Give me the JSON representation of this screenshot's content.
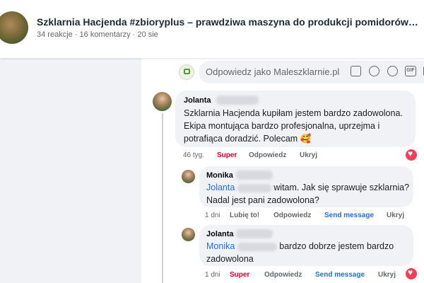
{
  "post": {
    "title": "Szklarnia Hacjenda #zbioryplus – prawdziwa maszyna do produkcji pomidorów…",
    "meta": "34 reakcje · 16 komentarzy · 20 sie"
  },
  "reply": {
    "placeholder": "Odpowiedz jako Maleszklarnie.pl",
    "icons": [
      "camera-icon",
      "emoji-icon",
      "gif-icon",
      "sticker-icon"
    ],
    "gif_label": "GIF"
  },
  "comments": [
    {
      "author": "Jolanta",
      "text": "Szklarnia Hacjenda kupiłam jestem bardzo zadowolona. Ekipa montująca bardzo profesjonalna, uprzejma i potrafiąca doradzić. Polecam 🥰",
      "time": "46 tyg.",
      "reaction": "Super",
      "reply_label": "Odpowiedz",
      "hide_label": "Ukryj"
    },
    {
      "author": "Monika",
      "mention": "Jolanta",
      "text": "witam. Jak się sprawuje szklarnia? Nadal jest pani zadowolona?",
      "time": "1 dni",
      "reaction": "Lubię to!",
      "reply_label": "Odpowiedz",
      "send_label": "Send message",
      "hide_label": "Ukryj"
    },
    {
      "author": "Jolanta",
      "mention": "Monika",
      "text": "bardzo dobrze jestem bardzo zadowolona",
      "time": "1 dni",
      "reaction": "Super",
      "reply_label": "Odpowiedz",
      "send_label": "Send message",
      "hide_label": "Ukryj"
    }
  ],
  "colors": {
    "link": "#216fdb",
    "super": "#e4002b",
    "heart": "#f33e58"
  }
}
